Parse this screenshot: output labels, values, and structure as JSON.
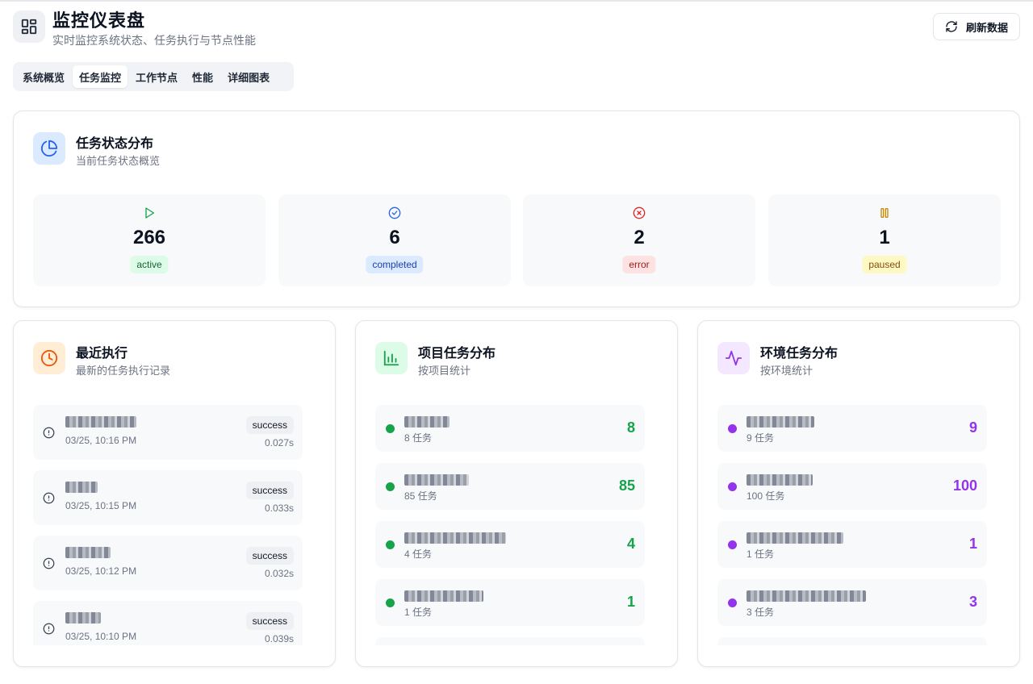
{
  "header": {
    "title": "监控仪表盘",
    "subtitle": "实时监控系统状态、任务执行与节点性能",
    "refresh_label": "刷新数据"
  },
  "tabs": [
    {
      "label": "系统概览",
      "active": false
    },
    {
      "label": "任务监控",
      "active": true
    },
    {
      "label": "工作节点",
      "active": false
    },
    {
      "label": "性能",
      "active": false
    },
    {
      "label": "详细图表",
      "active": false
    }
  ],
  "status_card": {
    "title": "任务状态分布",
    "subtitle": "当前任务状态概览",
    "stats": [
      {
        "value": "266",
        "label": "active",
        "icon": "play-icon",
        "color": "#16a34a",
        "bg": "#dcfce7",
        "fg": "#166534"
      },
      {
        "value": "6",
        "label": "completed",
        "icon": "check-circle-icon",
        "color": "#2563eb",
        "bg": "#dbeafe",
        "fg": "#1e40af"
      },
      {
        "value": "2",
        "label": "error",
        "icon": "x-circle-icon",
        "color": "#dc2626",
        "bg": "#fee2e2",
        "fg": "#991b1b"
      },
      {
        "value": "1",
        "label": "paused",
        "icon": "pause-icon",
        "color": "#ca8a04",
        "bg": "#fef9c3",
        "fg": "#854d0e"
      }
    ]
  },
  "recent_card": {
    "title": "最近执行",
    "subtitle": "最新的任务执行记录",
    "items": [
      {
        "time": "03/25, 10:16 PM",
        "status": "success",
        "duration": "0.027s"
      },
      {
        "time": "03/25, 10:15 PM",
        "status": "success",
        "duration": "0.033s"
      },
      {
        "time": "03/25, 10:12 PM",
        "status": "success",
        "duration": "0.032s"
      },
      {
        "time": "03/25, 10:10 PM",
        "status": "success",
        "duration": "0.039s"
      }
    ]
  },
  "project_card": {
    "title": "项目任务分布",
    "subtitle": "按项目统计",
    "color": "#16a34a",
    "items": [
      {
        "value": "8",
        "count": "8 任务"
      },
      {
        "value": "85",
        "count": "85 任务"
      },
      {
        "value": "4",
        "count": "4 任务"
      },
      {
        "value": "1",
        "count": "1 任务"
      }
    ]
  },
  "env_card": {
    "title": "环境任务分布",
    "subtitle": "按环境统计",
    "color": "#9333ea",
    "items": [
      {
        "value": "9",
        "count": "9 任务"
      },
      {
        "value": "100",
        "count": "100 任务"
      },
      {
        "value": "1",
        "count": "1 任务"
      },
      {
        "value": "3",
        "count": "3 任务"
      }
    ]
  }
}
